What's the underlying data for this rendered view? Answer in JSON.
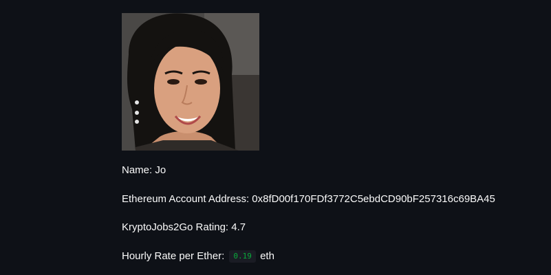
{
  "profile": {
    "photo_alt": "candidate-photo",
    "name_label": "Name: ",
    "name_value": "Jo",
    "address_label": "Ethereum Account Address: ",
    "address_value": "0x8fD00f170FDf3772C5ebdCD90bF257316c69BA45",
    "rating_label": "KryptoJobs2Go Rating: ",
    "rating_value": "4.7",
    "rate_label": "Hourly Rate per Ether:",
    "rate_value": "0.19",
    "rate_unit": "eth"
  },
  "colors": {
    "background": "#0e1117",
    "text": "#fafafa",
    "code_text": "#09ab3b",
    "code_bg": "#1a1c24"
  }
}
